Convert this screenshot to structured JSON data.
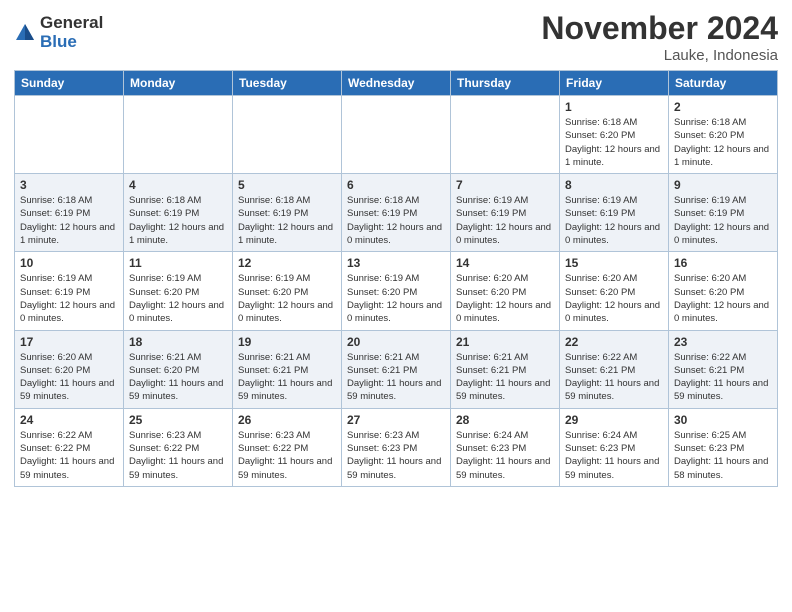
{
  "logo": {
    "general": "General",
    "blue": "Blue"
  },
  "header": {
    "month": "November 2024",
    "location": "Lauke, Indonesia"
  },
  "weekdays": [
    "Sunday",
    "Monday",
    "Tuesday",
    "Wednesday",
    "Thursday",
    "Friday",
    "Saturday"
  ],
  "weeks": [
    [
      {
        "day": "",
        "info": ""
      },
      {
        "day": "",
        "info": ""
      },
      {
        "day": "",
        "info": ""
      },
      {
        "day": "",
        "info": ""
      },
      {
        "day": "",
        "info": ""
      },
      {
        "day": "1",
        "info": "Sunrise: 6:18 AM\nSunset: 6:20 PM\nDaylight: 12 hours and 1 minute."
      },
      {
        "day": "2",
        "info": "Sunrise: 6:18 AM\nSunset: 6:20 PM\nDaylight: 12 hours and 1 minute."
      }
    ],
    [
      {
        "day": "3",
        "info": "Sunrise: 6:18 AM\nSunset: 6:19 PM\nDaylight: 12 hours and 1 minute."
      },
      {
        "day": "4",
        "info": "Sunrise: 6:18 AM\nSunset: 6:19 PM\nDaylight: 12 hours and 1 minute."
      },
      {
        "day": "5",
        "info": "Sunrise: 6:18 AM\nSunset: 6:19 PM\nDaylight: 12 hours and 1 minute."
      },
      {
        "day": "6",
        "info": "Sunrise: 6:18 AM\nSunset: 6:19 PM\nDaylight: 12 hours and 0 minutes."
      },
      {
        "day": "7",
        "info": "Sunrise: 6:19 AM\nSunset: 6:19 PM\nDaylight: 12 hours and 0 minutes."
      },
      {
        "day": "8",
        "info": "Sunrise: 6:19 AM\nSunset: 6:19 PM\nDaylight: 12 hours and 0 minutes."
      },
      {
        "day": "9",
        "info": "Sunrise: 6:19 AM\nSunset: 6:19 PM\nDaylight: 12 hours and 0 minutes."
      }
    ],
    [
      {
        "day": "10",
        "info": "Sunrise: 6:19 AM\nSunset: 6:19 PM\nDaylight: 12 hours and 0 minutes."
      },
      {
        "day": "11",
        "info": "Sunrise: 6:19 AM\nSunset: 6:20 PM\nDaylight: 12 hours and 0 minutes."
      },
      {
        "day": "12",
        "info": "Sunrise: 6:19 AM\nSunset: 6:20 PM\nDaylight: 12 hours and 0 minutes."
      },
      {
        "day": "13",
        "info": "Sunrise: 6:19 AM\nSunset: 6:20 PM\nDaylight: 12 hours and 0 minutes."
      },
      {
        "day": "14",
        "info": "Sunrise: 6:20 AM\nSunset: 6:20 PM\nDaylight: 12 hours and 0 minutes."
      },
      {
        "day": "15",
        "info": "Sunrise: 6:20 AM\nSunset: 6:20 PM\nDaylight: 12 hours and 0 minutes."
      },
      {
        "day": "16",
        "info": "Sunrise: 6:20 AM\nSunset: 6:20 PM\nDaylight: 12 hours and 0 minutes."
      }
    ],
    [
      {
        "day": "17",
        "info": "Sunrise: 6:20 AM\nSunset: 6:20 PM\nDaylight: 11 hours and 59 minutes."
      },
      {
        "day": "18",
        "info": "Sunrise: 6:21 AM\nSunset: 6:20 PM\nDaylight: 11 hours and 59 minutes."
      },
      {
        "day": "19",
        "info": "Sunrise: 6:21 AM\nSunset: 6:21 PM\nDaylight: 11 hours and 59 minutes."
      },
      {
        "day": "20",
        "info": "Sunrise: 6:21 AM\nSunset: 6:21 PM\nDaylight: 11 hours and 59 minutes."
      },
      {
        "day": "21",
        "info": "Sunrise: 6:21 AM\nSunset: 6:21 PM\nDaylight: 11 hours and 59 minutes."
      },
      {
        "day": "22",
        "info": "Sunrise: 6:22 AM\nSunset: 6:21 PM\nDaylight: 11 hours and 59 minutes."
      },
      {
        "day": "23",
        "info": "Sunrise: 6:22 AM\nSunset: 6:21 PM\nDaylight: 11 hours and 59 minutes."
      }
    ],
    [
      {
        "day": "24",
        "info": "Sunrise: 6:22 AM\nSunset: 6:22 PM\nDaylight: 11 hours and 59 minutes."
      },
      {
        "day": "25",
        "info": "Sunrise: 6:23 AM\nSunset: 6:22 PM\nDaylight: 11 hours and 59 minutes."
      },
      {
        "day": "26",
        "info": "Sunrise: 6:23 AM\nSunset: 6:22 PM\nDaylight: 11 hours and 59 minutes."
      },
      {
        "day": "27",
        "info": "Sunrise: 6:23 AM\nSunset: 6:23 PM\nDaylight: 11 hours and 59 minutes."
      },
      {
        "day": "28",
        "info": "Sunrise: 6:24 AM\nSunset: 6:23 PM\nDaylight: 11 hours and 59 minutes."
      },
      {
        "day": "29",
        "info": "Sunrise: 6:24 AM\nSunset: 6:23 PM\nDaylight: 11 hours and 59 minutes."
      },
      {
        "day": "30",
        "info": "Sunrise: 6:25 AM\nSunset: 6:23 PM\nDaylight: 11 hours and 58 minutes."
      }
    ]
  ]
}
